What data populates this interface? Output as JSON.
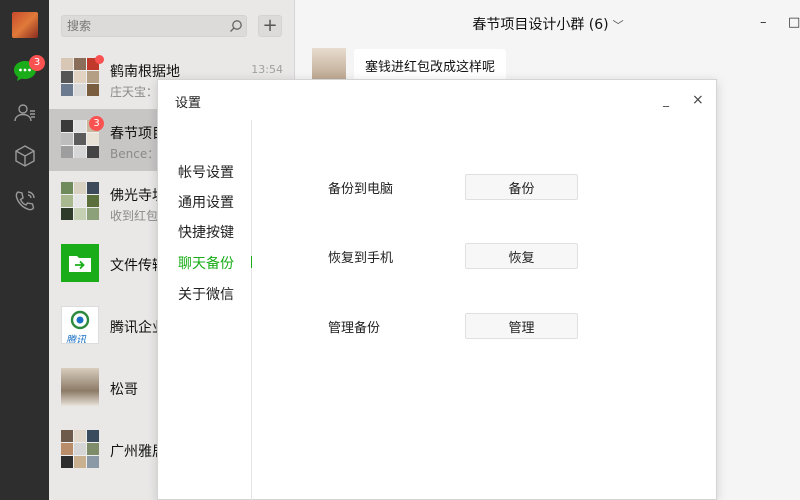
{
  "rail": {
    "badge": "3",
    "icons": [
      "chat-icon",
      "contacts-icon",
      "favorites-box-icon",
      "phone-icon"
    ]
  },
  "search": {
    "placeholder": "搜索"
  },
  "chats": [
    {
      "name": "鹤南根据地",
      "sub": "庄天宝：",
      "time": "13:54",
      "dot": true
    },
    {
      "name": "春节项目",
      "sub": "Bence：",
      "badge": "3",
      "active": true
    },
    {
      "name": "佛光寺坊",
      "sub": "收到红包"
    },
    {
      "name": "文件传输"
    },
    {
      "name": "腾讯企业",
      "logo_text": "腾讯"
    },
    {
      "name": "松哥"
    },
    {
      "name": "广州雅居"
    }
  ],
  "main": {
    "title": "春节项目设计小群 (6)",
    "message": "塞钱进红包改成这样呢"
  },
  "settings": {
    "title": "设置",
    "nav": [
      "帐号设置",
      "通用设置",
      "快捷按键",
      "聊天备份",
      "关于微信"
    ],
    "active_nav": "聊天备份",
    "options": [
      {
        "label": "备份到电脑",
        "button": "备份"
      },
      {
        "label": "恢复到手机",
        "button": "恢复"
      },
      {
        "label": "管理备份",
        "button": "管理"
      }
    ]
  },
  "colors": {
    "accent": "#1aad19",
    "badge": "#fa5151",
    "rail": "#2e2e2e"
  }
}
